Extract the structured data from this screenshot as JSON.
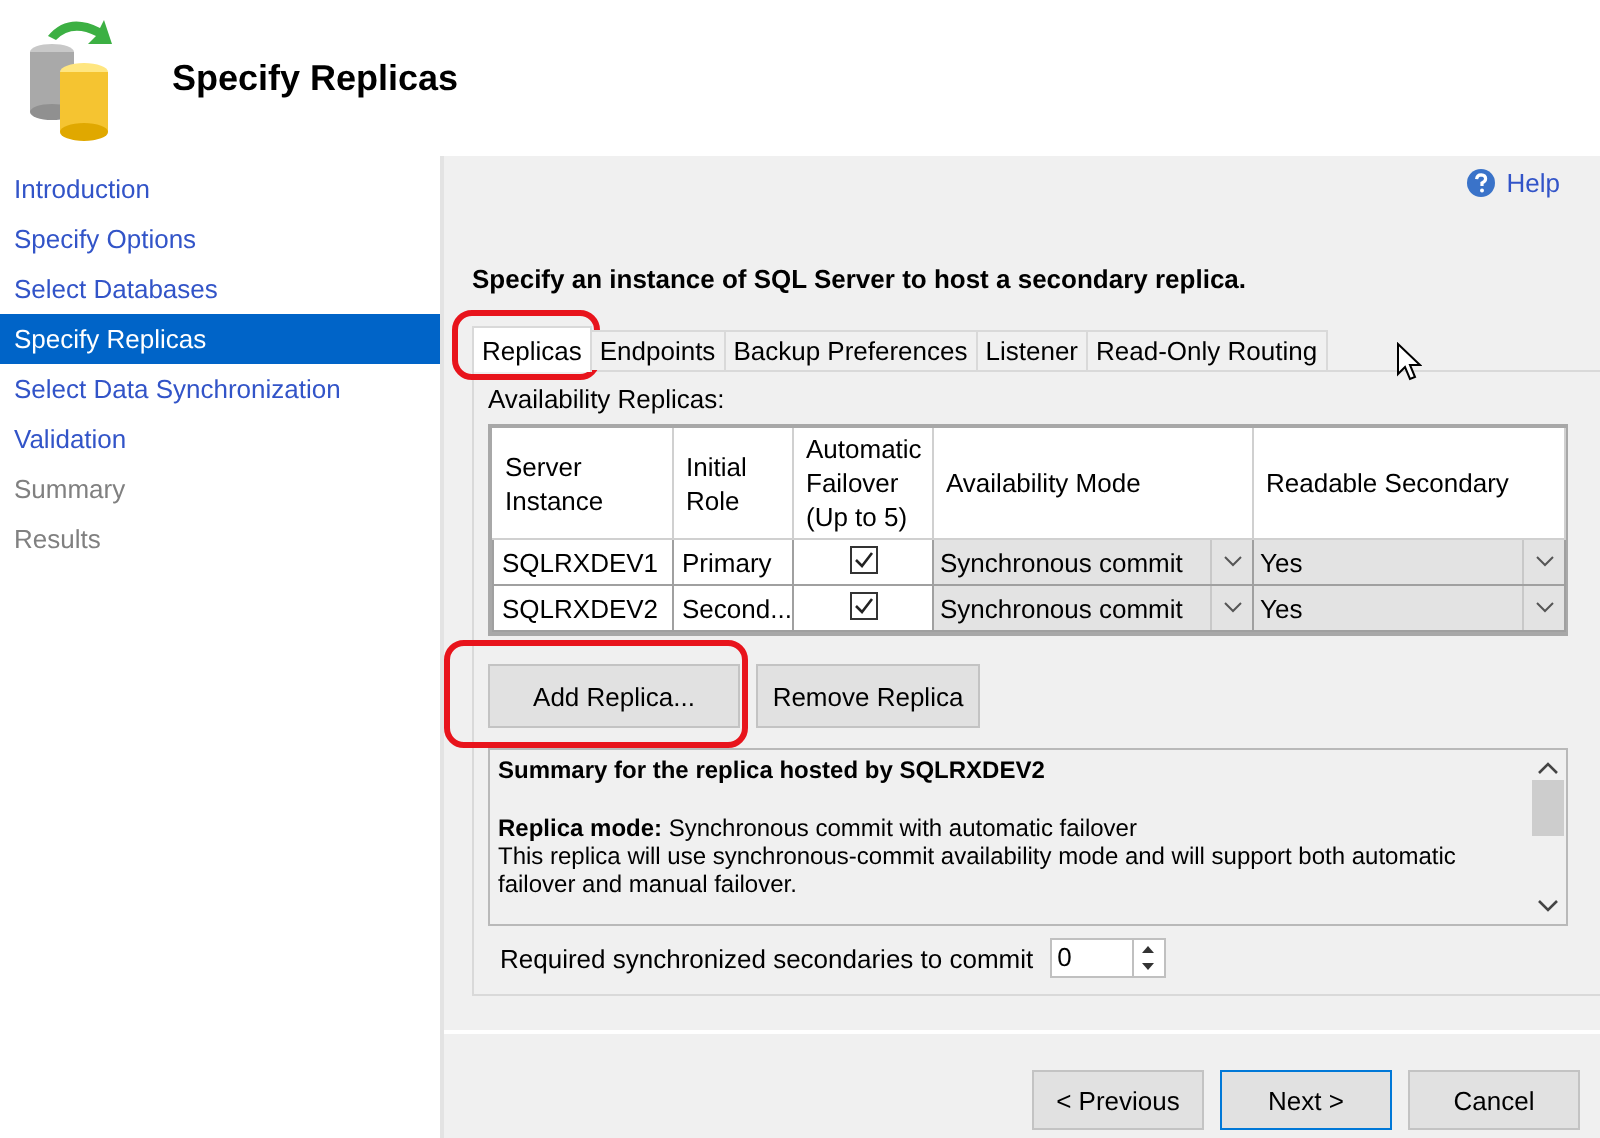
{
  "header": {
    "title": "Specify Replicas"
  },
  "sidebar": {
    "items": [
      {
        "label": "Introduction",
        "selected": false,
        "disabled": false
      },
      {
        "label": "Specify Options",
        "selected": false,
        "disabled": false
      },
      {
        "label": "Select Databases",
        "selected": false,
        "disabled": false
      },
      {
        "label": "Specify Replicas",
        "selected": true,
        "disabled": false
      },
      {
        "label": "Select Data Synchronization",
        "selected": false,
        "disabled": false
      },
      {
        "label": "Validation",
        "selected": false,
        "disabled": false
      },
      {
        "label": "Summary",
        "selected": false,
        "disabled": true
      },
      {
        "label": "Results",
        "selected": false,
        "disabled": true
      }
    ]
  },
  "help_link": "Help",
  "instruction": "Specify an instance of SQL Server to host a secondary replica.",
  "tabs": [
    {
      "label": "Replicas",
      "selected": true,
      "highlighted": true
    },
    {
      "label": "Endpoints",
      "selected": false,
      "highlighted": false
    },
    {
      "label": "Backup Preferences",
      "selected": false,
      "highlighted": false
    },
    {
      "label": "Listener",
      "selected": false,
      "highlighted": false
    },
    {
      "label": "Read-Only Routing",
      "selected": false,
      "highlighted": false
    }
  ],
  "replicas_label": "Availability Replicas:",
  "table": {
    "columns": [
      "Server Instance",
      "Initial Role",
      "Automatic Failover (Up to 5)",
      "Availability Mode",
      "Readable Secondary"
    ],
    "rows": [
      {
        "server": "SQLRXDEV1",
        "role": "Primary",
        "automatic_failover": true,
        "availability_mode": "Synchronous commit",
        "readable_secondary": "Yes"
      },
      {
        "server": "SQLRXDEV2",
        "role": "Second...",
        "automatic_failover": true,
        "availability_mode": "Synchronous commit",
        "readable_secondary": "Yes"
      }
    ]
  },
  "replica_buttons": [
    {
      "label": "Add Replica...",
      "highlighted": true
    },
    {
      "label": "Remove Replica",
      "highlighted": false
    }
  ],
  "summary": {
    "title": "Summary for the replica hosted by SQLRXDEV2",
    "lines": [
      "**Replica mode:** Synchronous commit with automatic failover",
      "This replica will use synchronous-commit availability mode and will support both automatic failover and manual failover."
    ]
  },
  "required_secondaries": {
    "label": "Required synchronized secondaries to commit",
    "value": "0"
  },
  "footer_buttons": [
    {
      "label": "< Previous",
      "default": false
    },
    {
      "label": "Next >",
      "default": true
    },
    {
      "label": "Cancel",
      "default": false
    }
  ]
}
